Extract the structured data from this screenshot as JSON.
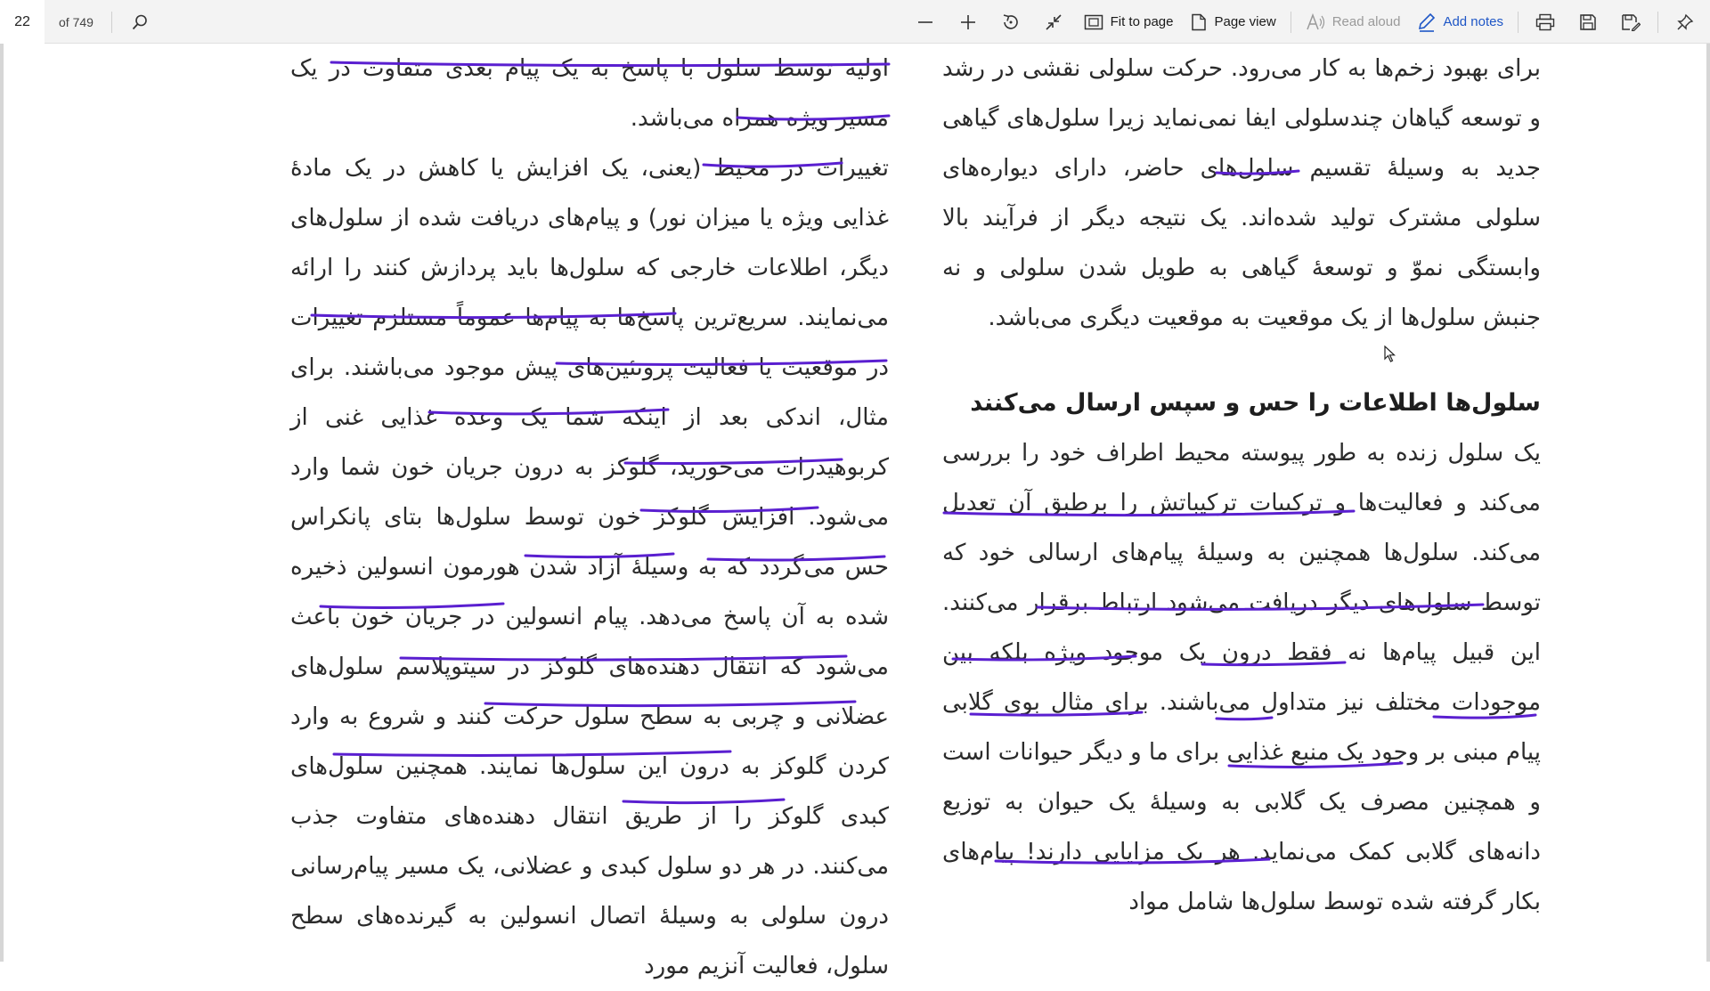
{
  "toolbar": {
    "page_number": "22",
    "page_total": "of 749",
    "search_icon": "search-icon",
    "zoom_out_icon": "minus-icon",
    "zoom_in_icon": "plus-icon",
    "rotate_icon": "rotate-icon",
    "collapse_icon": "collapse-icon",
    "fit_to_page_label": "Fit to page",
    "page_view_label": "Page view",
    "read_aloud_label": "Read aloud",
    "add_notes_label": "Add notes",
    "print_icon": "print-icon",
    "save_icon": "save-icon",
    "save_as_icon": "save-as-icon",
    "pin_icon": "pin-icon"
  },
  "colors": {
    "toolbar_bg": "#f3f3f3",
    "accent": "#1e56c6",
    "ink_underline": "#5a1fd0",
    "disabled_text": "#9a9a9a"
  },
  "document": {
    "left_column": {
      "paragraphs": [
        "اولیه توسط سلول با پاسخ به یک پیام بعدی متفاوت در یک مسیر ویژه همراه می‌باشد.",
        "تغییرات در محیط (یعنی، یک افزایش یا کاهش در یک مادهٔ غذایی ویژه یا میزان نور) و پیام‌های دریافت شده از سلول‌های دیگر، اطلاعات خارجی که سلول‌ها باید پردازش کنند را ارائه می‌نمایند. سریع‌ترین پاسخ‌ها به پیام‌ها عموماً مستلزم تغییرات در موقعیت یا فعالیت پروتئین‌های پیش موجود می‌باشند. برای مثال، اندکی بعد از اینکه شما یک وعده غذایی غنی از کربوهیدرات می‌خورید، گلوکز به درون جریان خون شما وارد می‌شود. افزایش گلوکز خون توسط سلول‌ها بتای پانکراس حس می‌گردد که به وسیلهٔ آزاد شدن هورمون انسولین ذخیره شده به آن پاسخ می‌دهد. پیام انسولین در جریان خون باعث می‌شود که انتقال دهنده‌های گلوکز در سیتوپلاسم سلول‌های عضلانی و چربی به سطح سلول حرکت کنند و شروع به وارد کردن گلوکز به درون این سلول‌ها نمایند. همچنین سلول‌های کبدی گلوکز را از طریق انتقال دهنده‌های متفاوت جذب می‌کنند. در هر دو سلول کبدی و عضلانی، یک مسیر پیام‌رسانی درون سلولی به وسیلهٔ اتصال انسولین به گیرنده‌های سطح سلول، فعالیت آنزیم مورد"
      ]
    },
    "right_column": {
      "intro_paragraph": "برای بهبود زخم‌ها به کار می‌رود. حرکت سلولی نقشی در رشد و توسعه گیاهان چندسلولی ایفا نمی‌نماید زیرا سلول‌های گیاهی جدید به وسیلهٔ تقسیم سلول‌های حاضر، دارای دیواره‌های سلولی مشترک تولید شده‌اند. یک نتیجه دیگر از فرآیند بالا وابستگی نموّ و توسعهٔ گیاهی به طویل شدن سلولی و نه جنبش سلول‌ها از یک موقعیت به موقعیت دیگری می‌باشد.",
      "heading": "سلول‌ها اطلاعات را حس و سپس ارسال می‌کنند",
      "body_paragraph": "یک سلول زنده به طور پیوسته محیط اطراف خود را بررسی می‌کند و فعالیت‌ها و ترکیبات ترکیباتش را برطبق آن تعدیل می‌کند. سلول‌ها همچنین به وسیلهٔ پیام‌های ارسالی خود که توسط سلول‌های دیگر دریافت می‌شود ارتباط برقرار می‌کنند. این قبیل پیام‌ها نه فقط درون یک موجود ویژه بلکه بین موجودات مختلف نیز متداول می‌باشند. برای مثال بوی گلابی پیام مبنی بر وجود یک منبع غذایی برای ما و دیگر حیوانات است و همچنین مصرف یک گلابی به وسیلهٔ یک حیوان به توزیع دانه‌های گلابی کمک می‌نماید. هر یک مزایایی دارند! پیام‌های بکار گرفته شده توسط سلول‌ها شامل مواد"
    }
  }
}
